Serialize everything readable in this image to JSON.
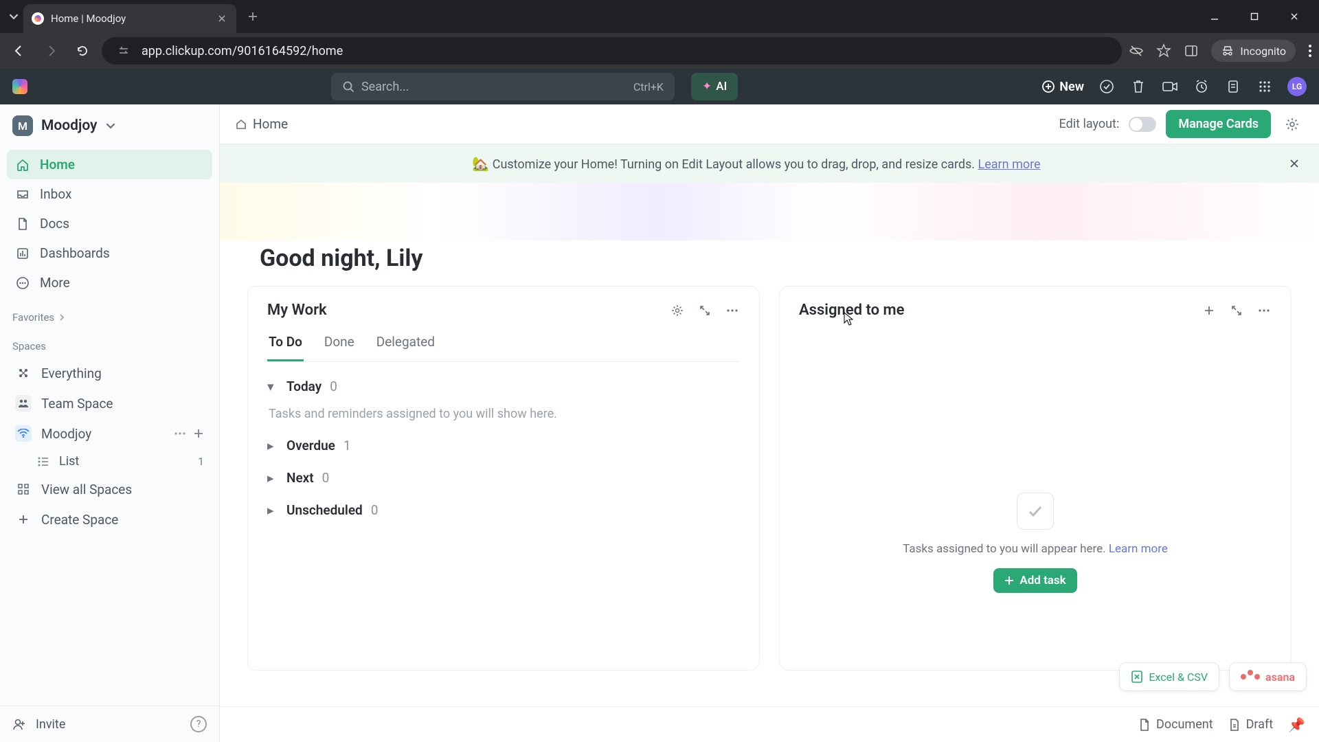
{
  "browser": {
    "tab_title": "Home | Moodjoy",
    "url": "app.clickup.com/9016164592/home",
    "incognito_label": "Incognito"
  },
  "topbar": {
    "search_placeholder": "Search...",
    "search_shortcut": "Ctrl+K",
    "ai_label": "AI",
    "new_label": "New",
    "avatar_initials": "LG"
  },
  "workspace": {
    "badge": "M",
    "name": "Moodjoy"
  },
  "sidebar": {
    "nav": [
      {
        "label": "Home",
        "icon": "home-icon",
        "active": true
      },
      {
        "label": "Inbox",
        "icon": "inbox-icon",
        "active": false
      },
      {
        "label": "Docs",
        "icon": "docs-icon",
        "active": false
      },
      {
        "label": "Dashboards",
        "icon": "dashboard-icon",
        "active": false
      },
      {
        "label": "More",
        "icon": "more-icon",
        "active": false
      }
    ],
    "favorites_label": "Favorites",
    "spaces_label": "Spaces",
    "spaces": {
      "everything_label": "Everything",
      "team_space_label": "Team Space",
      "moodjoy_label": "Moodjoy",
      "list_label": "List",
      "list_count": "1",
      "view_all_label": "View all Spaces",
      "create_label": "Create Space"
    },
    "invite_label": "Invite"
  },
  "header": {
    "breadcrumb": "Home",
    "edit_layout_label": "Edit layout:",
    "manage_cards_label": "Manage Cards"
  },
  "banner": {
    "emoji": "🏡",
    "text": "Customize your Home! Turning on Edit Layout allows you to drag, drop, and resize cards.",
    "link": "Learn more"
  },
  "greeting": "Good night, Lily",
  "my_work": {
    "title": "My Work",
    "tabs": {
      "todo": "To Do",
      "done": "Done",
      "delegated": "Delegated"
    },
    "groups": [
      {
        "name": "Today",
        "count": "0",
        "expanded": true,
        "empty": "Tasks and reminders assigned to you will show here."
      },
      {
        "name": "Overdue",
        "count": "1",
        "expanded": false
      },
      {
        "name": "Next",
        "count": "0",
        "expanded": false
      },
      {
        "name": "Unscheduled",
        "count": "0",
        "expanded": false
      }
    ]
  },
  "assigned": {
    "title": "Assigned to me",
    "empty_text": "Tasks assigned to you will appear here.",
    "learn_more": "Learn more",
    "add_task": "Add task"
  },
  "floaters": {
    "excel": "Excel & CSV",
    "asana": "asana"
  },
  "status": {
    "document": "Document",
    "draft": "Draft"
  }
}
